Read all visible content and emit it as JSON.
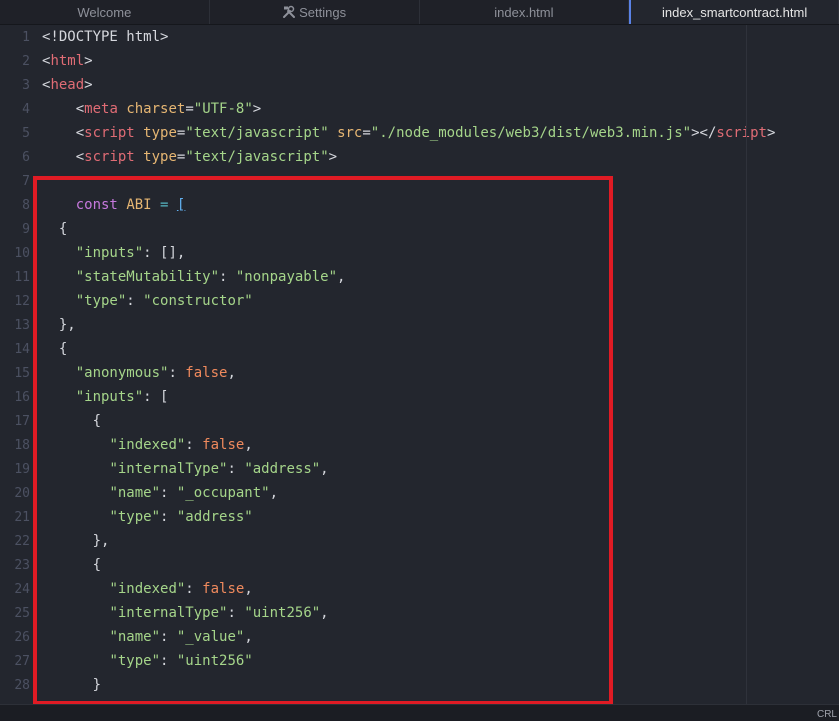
{
  "tabs": [
    {
      "label": "Welcome",
      "icon": "",
      "active": false
    },
    {
      "label": "Settings",
      "icon": "settings-icon",
      "active": false
    },
    {
      "label": "index.html",
      "icon": "",
      "active": false
    },
    {
      "label": "index_smartcontract.html",
      "icon": "",
      "active": true
    }
  ],
  "editor": {
    "lines": [
      {
        "n": "1",
        "segs": [
          {
            "t": "<!DOCTYPE html>",
            "c": "code"
          }
        ]
      },
      {
        "n": "2",
        "segs": [
          {
            "t": "<",
            "c": "code"
          },
          {
            "t": "html",
            "c": "t-tag"
          },
          {
            "t": ">",
            "c": "code"
          }
        ]
      },
      {
        "n": "3",
        "segs": [
          {
            "t": "<",
            "c": "code"
          },
          {
            "t": "head",
            "c": "t-tag"
          },
          {
            "t": ">",
            "c": "code"
          }
        ]
      },
      {
        "n": "4",
        "segs": [
          {
            "t": "    <",
            "c": "code"
          },
          {
            "t": "meta",
            "c": "t-tag"
          },
          {
            "t": " ",
            "c": "code"
          },
          {
            "t": "charset",
            "c": "t-attr"
          },
          {
            "t": "=",
            "c": "code"
          },
          {
            "t": "\"UTF-8\"",
            "c": "t-str"
          },
          {
            "t": ">",
            "c": "code"
          }
        ]
      },
      {
        "n": "5",
        "segs": [
          {
            "t": "    <",
            "c": "code"
          },
          {
            "t": "script",
            "c": "t-tag"
          },
          {
            "t": " ",
            "c": "code"
          },
          {
            "t": "type",
            "c": "t-attr"
          },
          {
            "t": "=",
            "c": "code"
          },
          {
            "t": "\"text/javascript\"",
            "c": "t-str"
          },
          {
            "t": " ",
            "c": "code"
          },
          {
            "t": "src",
            "c": "t-attr"
          },
          {
            "t": "=",
            "c": "code"
          },
          {
            "t": "\"./node_modules/web3/dist/web3.min.js\"",
            "c": "t-str"
          },
          {
            "t": "></",
            "c": "code"
          },
          {
            "t": "script",
            "c": "t-tag"
          },
          {
            "t": ">",
            "c": "code"
          }
        ]
      },
      {
        "n": "6",
        "segs": [
          {
            "t": "    <",
            "c": "code"
          },
          {
            "t": "script",
            "c": "t-tag"
          },
          {
            "t": " ",
            "c": "code"
          },
          {
            "t": "type",
            "c": "t-attr"
          },
          {
            "t": "=",
            "c": "code"
          },
          {
            "t": "\"text/javascript\"",
            "c": "t-str"
          },
          {
            "t": ">",
            "c": "code"
          }
        ]
      },
      {
        "n": "7",
        "segs": []
      },
      {
        "n": "8",
        "segs": [
          {
            "t": "    ",
            "c": "code"
          },
          {
            "t": "const",
            "c": "t-kw"
          },
          {
            "t": " ",
            "c": "code"
          },
          {
            "t": "ABI",
            "c": "t-const"
          },
          {
            "t": " ",
            "c": "code"
          },
          {
            "t": "=",
            "c": "t-op"
          },
          {
            "t": " ",
            "c": "code"
          },
          {
            "t": "[",
            "c": "t-blue"
          }
        ]
      },
      {
        "n": "9",
        "segs": [
          {
            "t": "  {",
            "c": "code"
          }
        ]
      },
      {
        "n": "10",
        "segs": [
          {
            "t": "    ",
            "c": "code"
          },
          {
            "t": "\"inputs\"",
            "c": "t-key"
          },
          {
            "t": ": [],",
            "c": "code"
          }
        ]
      },
      {
        "n": "11",
        "segs": [
          {
            "t": "    ",
            "c": "code"
          },
          {
            "t": "\"stateMutability\"",
            "c": "t-key"
          },
          {
            "t": ": ",
            "c": "code"
          },
          {
            "t": "\"nonpayable\"",
            "c": "t-str"
          },
          {
            "t": ",",
            "c": "code"
          }
        ]
      },
      {
        "n": "12",
        "segs": [
          {
            "t": "    ",
            "c": "code"
          },
          {
            "t": "\"type\"",
            "c": "t-key"
          },
          {
            "t": ": ",
            "c": "code"
          },
          {
            "t": "\"constructor\"",
            "c": "t-str"
          }
        ]
      },
      {
        "n": "13",
        "segs": [
          {
            "t": "  },",
            "c": "code"
          }
        ]
      },
      {
        "n": "14",
        "segs": [
          {
            "t": "  {",
            "c": "code"
          }
        ]
      },
      {
        "n": "15",
        "segs": [
          {
            "t": "    ",
            "c": "code"
          },
          {
            "t": "\"anonymous\"",
            "c": "t-key"
          },
          {
            "t": ": ",
            "c": "code"
          },
          {
            "t": "false",
            "c": "t-bool"
          },
          {
            "t": ",",
            "c": "code"
          }
        ]
      },
      {
        "n": "16",
        "segs": [
          {
            "t": "    ",
            "c": "code"
          },
          {
            "t": "\"inputs\"",
            "c": "t-key"
          },
          {
            "t": ": [",
            "c": "code"
          }
        ]
      },
      {
        "n": "17",
        "segs": [
          {
            "t": "      {",
            "c": "code"
          }
        ]
      },
      {
        "n": "18",
        "segs": [
          {
            "t": "        ",
            "c": "code"
          },
          {
            "t": "\"indexed\"",
            "c": "t-key"
          },
          {
            "t": ": ",
            "c": "code"
          },
          {
            "t": "false",
            "c": "t-bool"
          },
          {
            "t": ",",
            "c": "code"
          }
        ]
      },
      {
        "n": "19",
        "segs": [
          {
            "t": "        ",
            "c": "code"
          },
          {
            "t": "\"internalType\"",
            "c": "t-key"
          },
          {
            "t": ": ",
            "c": "code"
          },
          {
            "t": "\"address\"",
            "c": "t-str"
          },
          {
            "t": ",",
            "c": "code"
          }
        ]
      },
      {
        "n": "20",
        "segs": [
          {
            "t": "        ",
            "c": "code"
          },
          {
            "t": "\"name\"",
            "c": "t-key"
          },
          {
            "t": ": ",
            "c": "code"
          },
          {
            "t": "\"_occupant\"",
            "c": "t-str"
          },
          {
            "t": ",",
            "c": "code"
          }
        ]
      },
      {
        "n": "21",
        "segs": [
          {
            "t": "        ",
            "c": "code"
          },
          {
            "t": "\"type\"",
            "c": "t-key"
          },
          {
            "t": ": ",
            "c": "code"
          },
          {
            "t": "\"address\"",
            "c": "t-str"
          }
        ]
      },
      {
        "n": "22",
        "segs": [
          {
            "t": "      },",
            "c": "code"
          }
        ]
      },
      {
        "n": "23",
        "segs": [
          {
            "t": "      {",
            "c": "code"
          }
        ]
      },
      {
        "n": "24",
        "segs": [
          {
            "t": "        ",
            "c": "code"
          },
          {
            "t": "\"indexed\"",
            "c": "t-key"
          },
          {
            "t": ": ",
            "c": "code"
          },
          {
            "t": "false",
            "c": "t-bool"
          },
          {
            "t": ",",
            "c": "code"
          }
        ]
      },
      {
        "n": "25",
        "segs": [
          {
            "t": "        ",
            "c": "code"
          },
          {
            "t": "\"internalType\"",
            "c": "t-key"
          },
          {
            "t": ": ",
            "c": "code"
          },
          {
            "t": "\"uint256\"",
            "c": "t-str"
          },
          {
            "t": ",",
            "c": "code"
          }
        ]
      },
      {
        "n": "26",
        "segs": [
          {
            "t": "        ",
            "c": "code"
          },
          {
            "t": "\"name\"",
            "c": "t-key"
          },
          {
            "t": ": ",
            "c": "code"
          },
          {
            "t": "\"_value\"",
            "c": "t-str"
          },
          {
            "t": ",",
            "c": "code"
          }
        ]
      },
      {
        "n": "27",
        "segs": [
          {
            "t": "        ",
            "c": "code"
          },
          {
            "t": "\"type\"",
            "c": "t-key"
          },
          {
            "t": ": ",
            "c": "code"
          },
          {
            "t": "\"uint256\"",
            "c": "t-str"
          }
        ]
      },
      {
        "n": "28",
        "segs": [
          {
            "t": "      }",
            "c": "code"
          }
        ]
      }
    ]
  },
  "highlight": {
    "color": "#e01b24"
  },
  "statusbar": {
    "right_text": "CRL"
  }
}
